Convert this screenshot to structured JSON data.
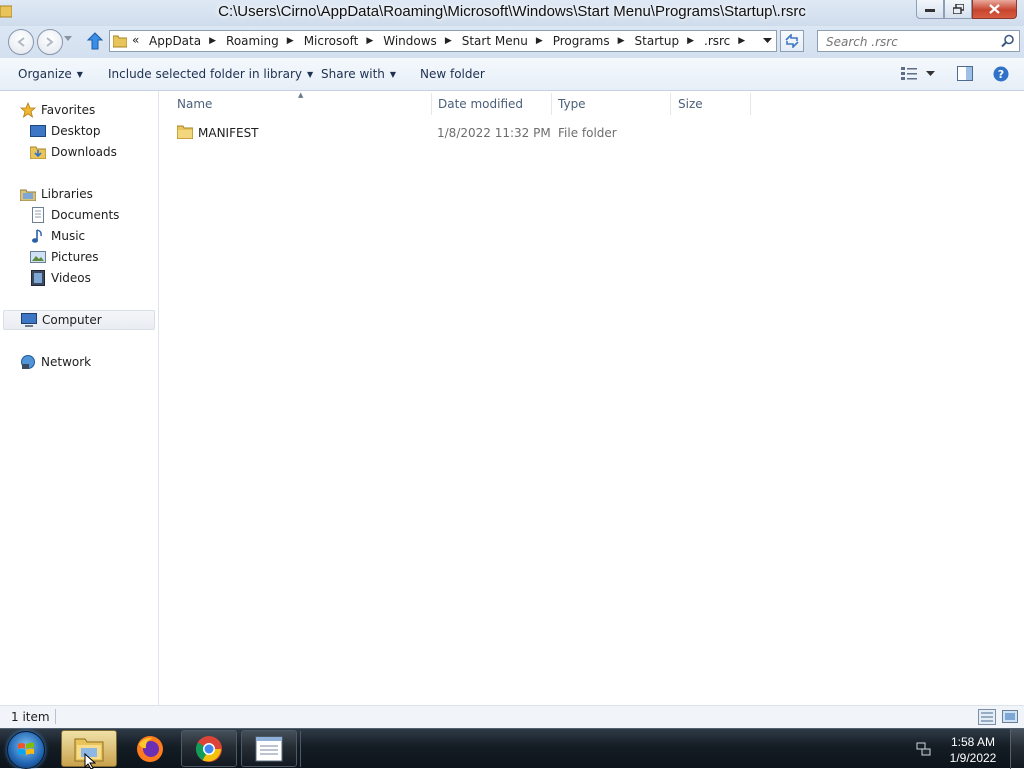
{
  "window": {
    "title": "C:\\Users\\Cirno\\AppData\\Roaming\\Microsoft\\Windows\\Start Menu\\Programs\\Startup\\.rsrc"
  },
  "address": {
    "overflow": "«",
    "crumbs": [
      "AppData",
      "Roaming",
      "Microsoft",
      "Windows",
      "Start Menu",
      "Programs",
      "Startup",
      ".rsrc"
    ],
    "sep": "▶"
  },
  "search": {
    "placeholder": "Search .rsrc"
  },
  "toolbar": {
    "organize": "Organize",
    "include": "Include selected folder in library",
    "share": "Share with",
    "new_folder": "New folder"
  },
  "nav": {
    "favorites": "Favorites",
    "desktop": "Desktop",
    "downloads": "Downloads",
    "libraries": "Libraries",
    "documents": "Documents",
    "music": "Music",
    "pictures": "Pictures",
    "videos": "Videos",
    "computer": "Computer",
    "network": "Network"
  },
  "columns": {
    "name": "Name",
    "date": "Date modified",
    "type": "Type",
    "size": "Size"
  },
  "files": [
    {
      "name": "MANIFEST",
      "date": "1/8/2022 11:32 PM",
      "type": "File folder",
      "size": ""
    }
  ],
  "status": {
    "count": "1 item"
  },
  "taskbar": {
    "apps": [
      "windows-explorer",
      "firefox",
      "chrome",
      "notepad"
    ],
    "time": "1:58 AM",
    "date": "1/9/2022"
  },
  "colors": {
    "folder_yellow": "#e8c45a",
    "accent_blue": "#1e3150",
    "close_red": "#c7452f"
  }
}
